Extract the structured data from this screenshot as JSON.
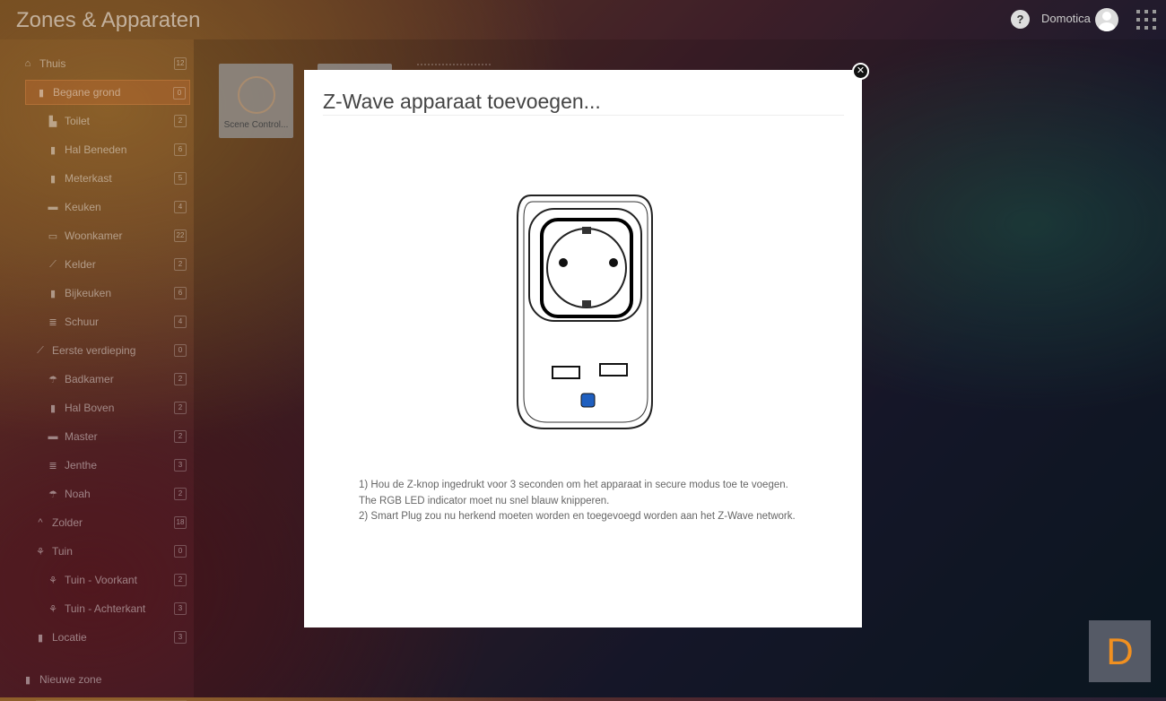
{
  "header": {
    "title": "Zones & Apparaten",
    "user": "Domotica",
    "help": "?"
  },
  "sidebar": {
    "items": [
      {
        "label": "Thuis",
        "count": "12",
        "icon": "home-icon"
      },
      {
        "label": "Begane grond",
        "count": "0",
        "icon": "door-icon"
      },
      {
        "label": "Toilet",
        "count": "2",
        "icon": "toilet-icon"
      },
      {
        "label": "Hal Beneden",
        "count": "6",
        "icon": "door-icon"
      },
      {
        "label": "Meterkast",
        "count": "5",
        "icon": "door-icon"
      },
      {
        "label": "Keuken",
        "count": "4",
        "icon": "kitchen-icon"
      },
      {
        "label": "Woonkamer",
        "count": "22",
        "icon": "sofa-icon"
      },
      {
        "label": "Kelder",
        "count": "2",
        "icon": "stairs-icon"
      },
      {
        "label": "Bijkeuken",
        "count": "6",
        "icon": "door-icon"
      },
      {
        "label": "Schuur",
        "count": "4",
        "icon": "shelf-icon"
      },
      {
        "label": "Eerste verdieping",
        "count": "0",
        "icon": "stairs-icon"
      },
      {
        "label": "Badkamer",
        "count": "2",
        "icon": "shower-icon"
      },
      {
        "label": "Hal Boven",
        "count": "2",
        "icon": "door-icon"
      },
      {
        "label": "Master",
        "count": "2",
        "icon": "bed-icon"
      },
      {
        "label": "Jenthe",
        "count": "3",
        "icon": "shelf-icon"
      },
      {
        "label": "Noah",
        "count": "2",
        "icon": "shower-icon"
      },
      {
        "label": "Zolder",
        "count": "18",
        "icon": "roof-icon"
      },
      {
        "label": "Tuin",
        "count": "0",
        "icon": "flower-icon"
      },
      {
        "label": "Tuin - Voorkant",
        "count": "2",
        "icon": "flower-icon"
      },
      {
        "label": "Tuin - Achterkant",
        "count": "3",
        "icon": "flower-icon"
      },
      {
        "label": "Locatie",
        "count": "3",
        "icon": "door-icon"
      }
    ],
    "new_zone": "Nieuwe zone"
  },
  "tiles": [
    {
      "label": "Scene Control..."
    }
  ],
  "modal": {
    "title": "Z-Wave apparaat toevoegen...",
    "instructions": [
      "1) Hou de Z-knop ingedrukt voor 3 seconden om het apparaat in secure modus toe te voegen.",
      "The RGB LED indicator moet nu snel blauw knipperen.",
      "2) Smart Plug zou nu herkend moeten worden en toegevoegd worden aan het Z-Wave network."
    ]
  },
  "logo": "D"
}
